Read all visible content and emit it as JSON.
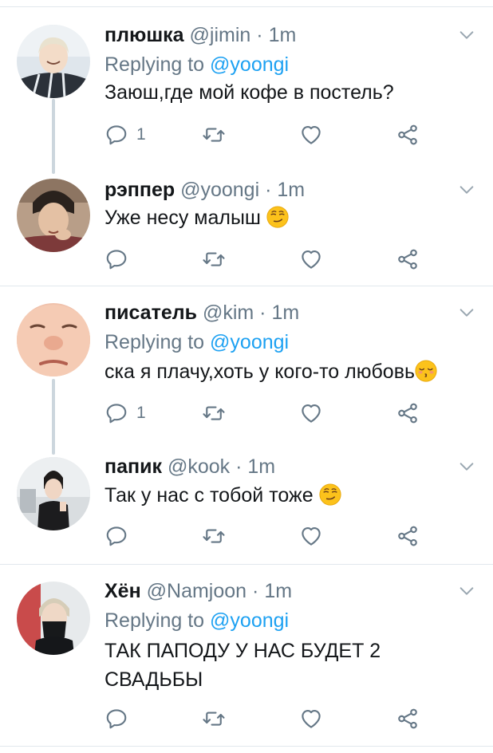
{
  "tweets": [
    {
      "name": "плюшка",
      "handle": "@jimin",
      "dot": "·",
      "time": "1m",
      "replying_prefix": "Replying to",
      "replying_mention": "@yoongi",
      "text": "Заюш,где мой кофе в постель?",
      "reply_count": "1"
    },
    {
      "name": "рэппер",
      "handle": "@yoongi",
      "dot": "·",
      "time": "1m",
      "text": "Уже несу малыш",
      "emoji": "smirk"
    },
    {
      "name": "писатель",
      "handle": "@kim",
      "dot": "·",
      "time": "1m",
      "replying_prefix": "Replying to",
      "replying_mention": "@yoongi",
      "text": "ска я плачу,хоть у кого-то любовь",
      "emoji": "kissing-closed-eyes",
      "reply_count": "1"
    },
    {
      "name": "папик",
      "handle": "@kook",
      "dot": "·",
      "time": "1m",
      "text": "Так у нас с тобой тоже",
      "emoji": "smirk"
    },
    {
      "name": "Хён",
      "handle": "@Namjoon",
      "dot": "·",
      "time": "1m",
      "replying_prefix": "Replying to",
      "replying_mention": "@yoongi",
      "text_line1": "ТАК ПАПОДУ У НАС БУДЕТ 2",
      "text_line2": "СВАДЬБЫ"
    }
  ],
  "icons": {
    "reply": "reply-icon",
    "retweet": "retweet-icon",
    "like": "heart-icon",
    "share": "share-icon",
    "menu": "chevron-down-icon"
  },
  "colors": {
    "mention": "#1da1f2",
    "secondary_text": "#657786",
    "separator": "#e1e8ed",
    "thread_line": "#ccd6dd"
  }
}
